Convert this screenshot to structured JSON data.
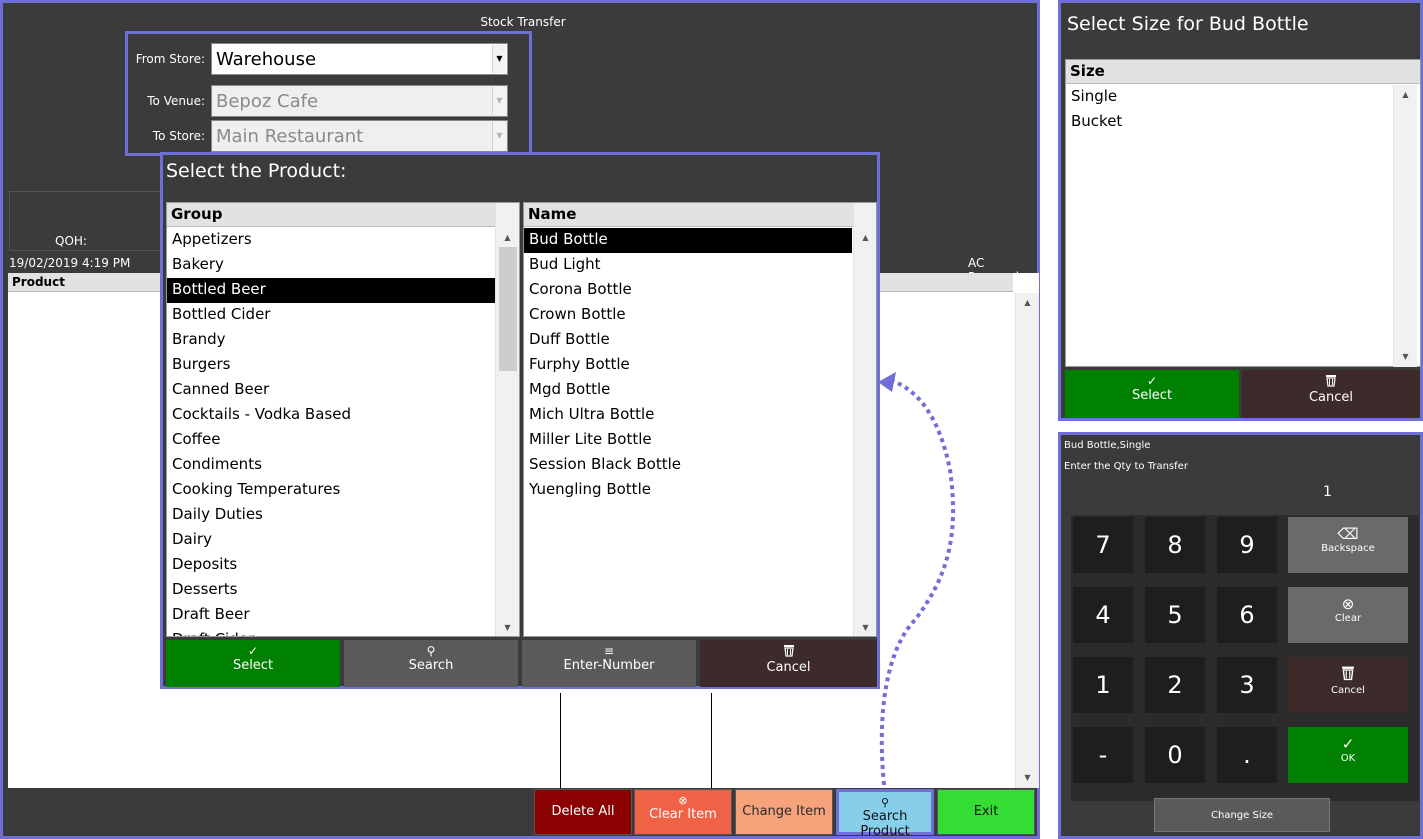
{
  "main": {
    "title": "Stock Transfer",
    "from_store_label": "From Store:",
    "from_store_value": "Warehouse",
    "to_venue_label": "To Venue:",
    "to_venue_value": "Bepoz Cafe",
    "to_store_label": "To Store:",
    "to_store_value": "Main Restaurant",
    "qoh_label": "QOH:",
    "datetime": "19/02/2019 4:19 PM",
    "ac_powered": "AC Powered",
    "grid_header": "Product",
    "buttons": {
      "delete_all": "Delete All",
      "clear_item": "Clear Item",
      "change_item": "Change Item",
      "search_product": "Search Product",
      "exit": "Exit"
    }
  },
  "product_dialog": {
    "title": "Select the Product:",
    "group_header": "Group",
    "name_header": "Name",
    "groups": [
      "Appetizers",
      "Bakery",
      "Bottled Beer",
      "Bottled Cider",
      "Brandy",
      "Burgers",
      "Canned Beer",
      "Cocktails - Vodka Based",
      "Coffee",
      "Condiments",
      "Cooking Temperatures",
      "Daily Duties",
      "Dairy",
      "Deposits",
      "Desserts",
      "Draft Beer",
      "Draft Cider"
    ],
    "selected_group": "Bottled Beer",
    "names": [
      "Bud Bottle",
      "Bud Light",
      "Corona Bottle",
      "Crown Bottle",
      "Duff Bottle",
      "Furphy Bottle",
      "Mgd Bottle",
      "Mich Ultra Bottle",
      "Miller Lite Bottle",
      "Session Black Bottle",
      "Yuengling Bottle"
    ],
    "selected_name": "Bud Bottle",
    "buttons": {
      "select": "Select",
      "search": "Search",
      "enter_number": "Enter-Number",
      "cancel": "Cancel"
    }
  },
  "size_dialog": {
    "title": "Select Size for Bud Bottle",
    "header": "Size",
    "sizes": [
      "Single",
      "Bucket"
    ],
    "buttons": {
      "select": "Select",
      "cancel": "Cancel"
    }
  },
  "qty_dialog": {
    "product": "Bud Bottle,Single",
    "prompt": "Enter the Qty to Transfer",
    "value": "1",
    "keys": [
      "7",
      "8",
      "9",
      "4",
      "5",
      "6",
      "1",
      "2",
      "3",
      "-",
      "0",
      "."
    ],
    "backspace": "Backspace",
    "clear": "Clear",
    "cancel": "Cancel",
    "ok": "OK",
    "change_size": "Change Size"
  },
  "colors": {
    "accent_border": "#6f6fd6",
    "select_green": "#008000",
    "cancel_brown": "#3d2b2b",
    "delete_red": "#8b0000",
    "clear_orange": "#f06246",
    "change_salmon": "#f6a27a",
    "search_blue": "#87ceeb",
    "exit_green": "#33dd33"
  },
  "icons": {
    "check": "✓",
    "search": "⚲",
    "list": "≡",
    "trash": "🗑",
    "clear_circle": "⊗",
    "backspace": "⌫"
  }
}
